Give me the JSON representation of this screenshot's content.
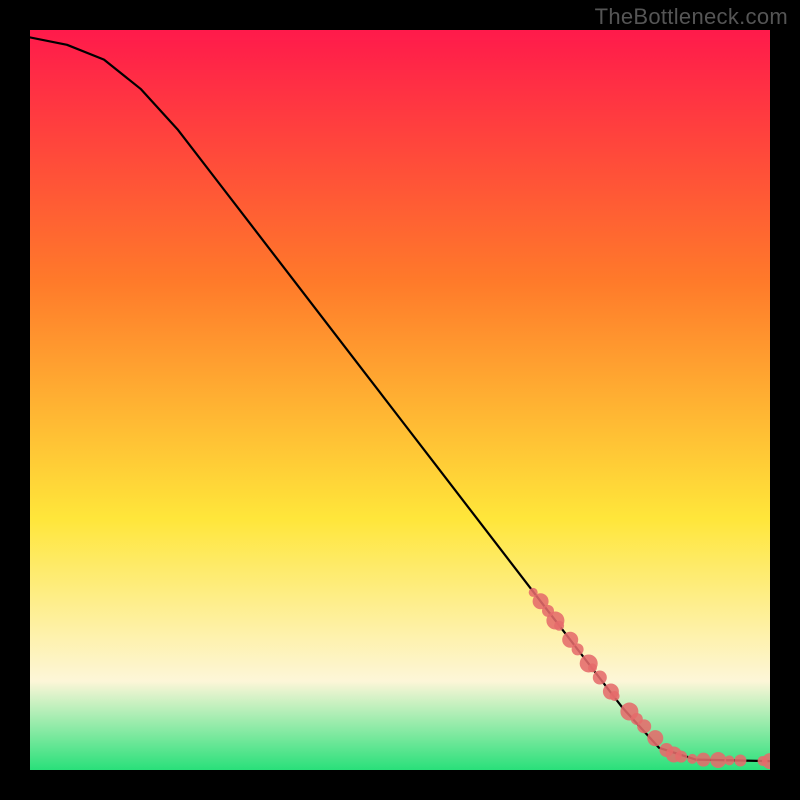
{
  "watermark": "TheBottleneck.com",
  "colors": {
    "gradient_top": "#ff1a4b",
    "gradient_upper_mid": "#ff7a2a",
    "gradient_lower_mid": "#ffe63a",
    "gradient_cream": "#fdf6d8",
    "gradient_bottom": "#29e07a",
    "curve": "#000000",
    "marker_fill": "#e56b6b",
    "marker_stroke": "#c94f4f",
    "background": "#000000"
  },
  "chart_data": {
    "type": "line",
    "title": "",
    "xlabel": "",
    "ylabel": "",
    "xlim": [
      0,
      100
    ],
    "ylim": [
      0,
      100
    ],
    "series": [
      {
        "name": "bottleneck-curve",
        "x": [
          0,
          5,
          10,
          15,
          20,
          25,
          30,
          35,
          40,
          45,
          50,
          55,
          60,
          65,
          70,
          75,
          80,
          85,
          90,
          95,
          100
        ],
        "y": [
          99,
          98,
          96,
          92,
          86.5,
          80,
          73.5,
          67,
          60.5,
          54,
          47.5,
          41,
          34.5,
          28,
          21.5,
          15,
          8.5,
          3,
          1.4,
          1.3,
          1.2
        ]
      }
    ],
    "markers": {
      "name": "highlighted-points",
      "x": [
        68,
        69,
        70,
        71,
        71.5,
        73,
        74,
        75.5,
        76,
        77,
        78.5,
        79,
        81,
        82,
        83,
        84.5,
        86,
        87,
        88,
        89.5,
        91,
        93,
        94.5,
        96,
        99,
        100
      ],
      "y": [
        24,
        22.8,
        21.5,
        20.2,
        19.5,
        17.6,
        16.3,
        14.4,
        13.8,
        12.5,
        10.6,
        10,
        7.9,
        6.9,
        5.9,
        4.3,
        2.7,
        2.1,
        1.8,
        1.5,
        1.4,
        1.35,
        1.3,
        1.28,
        1.22,
        1.2
      ],
      "r": [
        4.5,
        8,
        6,
        9,
        5,
        8,
        6,
        9,
        4.5,
        7,
        8,
        5,
        9,
        6,
        7,
        8,
        7,
        8,
        6,
        5,
        7,
        8,
        5,
        6,
        5,
        8
      ]
    }
  }
}
